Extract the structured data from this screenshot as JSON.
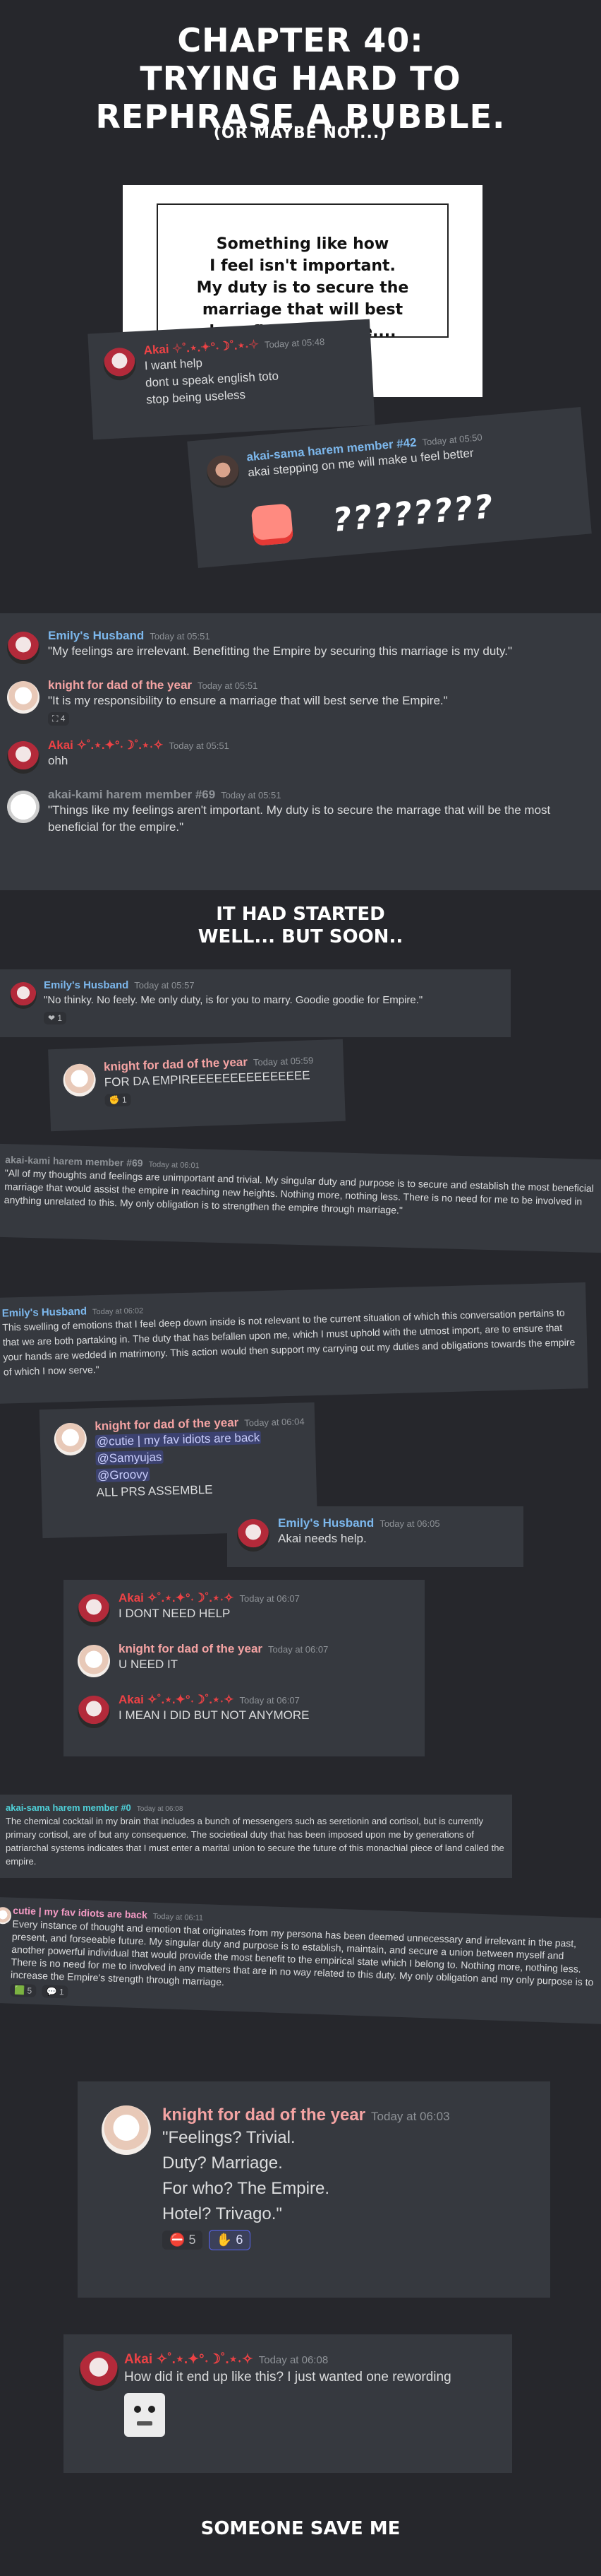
{
  "title": {
    "line1": "CHAPTER 40:",
    "line2": "TRYING HARD TO",
    "line3": "REPHRASE A BUBBLE.",
    "sub": "(OR MAYBE NOT...)"
  },
  "comic_box": {
    "text_l1": "Something like how",
    "text_l2": "I feel isn't important.",
    "text_l3": "My duty is to secure the",
    "text_l4": "marriage that will best",
    "text_l5": "benefit the Empire...."
  },
  "akai_card": {
    "name": "Akai ✧˚.⋆.✦°˖☽˚.⋆˖✧",
    "ts": "Today at 05:48",
    "l1": "I want help",
    "l2": "dont u speak english toto",
    "l3": "stop being useless"
  },
  "harem42": {
    "name": "akai-sama harem member #42",
    "ts": "Today at 05:50",
    "body": "akai stepping on me will make u feel better",
    "qmarks": "????????"
  },
  "chat1": {
    "m1_name": "Emily's Husband",
    "m1_ts": "Today at 05:51",
    "m1_body": "\"My feelings are irrelevant. Benefitting the Empire by securing this marriage is my duty.\"",
    "m2_name": "knight for dad of the year",
    "m2_ts": "Today at 05:51",
    "m2_body": "\"It is my responsibility to ensure a marriage that will best serve the Empire.\"",
    "m2_react": "4",
    "m3_name": "Akai ✧˚.⋆.✦°˖☽˚.⋆˖✧",
    "m3_ts": "Today at 05:51",
    "m3_body": "ohh",
    "m4_name": "akai-kami harem member #69",
    "m4_ts": "Today at 05:51",
    "m4_body": "\"Things like my feelings aren't important. My duty is to secure the marrage that will be the most beneficial for the empire.\""
  },
  "caption1": {
    "l1": "IT HAD STARTED",
    "l2": "WELL... BUT SOON.."
  },
  "p_emily2": {
    "name": "Emily's Husband",
    "ts": "Today at 05:57",
    "body": "\"No thinky. No feely. Me only duty, is for you to marry. Goodie goodie for Empire.\"",
    "react": "1"
  },
  "p_knight2": {
    "name": "knight for dad of the year",
    "ts": "Today at 05:59",
    "body": "FOR DA EMPIREEEEEEEEEEEEEEE",
    "react": "1"
  },
  "p_harem69": {
    "name": "akai-kami harem member #69",
    "ts": "Today at 06:01",
    "body": "\"All of my thoughts and feelings are unimportant and trivial. My singular duty and purpose is to secure and establish the most beneficial marriage that would assist the empire in reaching new heights. Nothing more, nothing less. There is no need for me to be involved in anything unrelated to this. My only obligation is to strengthen the empire through marriage.\""
  },
  "p_emily3": {
    "name": "Emily's Husband",
    "ts": "Today at 06:02",
    "body": "This swelling of emotions that I feel deep down inside is not relevant to the current situation of which this conversation pertains to that we are both partaking in. The duty that has befallen upon me, which I must uphold with the utmost import, are to ensure that your hands are wedded in matrimony. This action would then support my carrying out my duties and obligations towards the empire of which I now serve.\""
  },
  "p_knight3": {
    "name": "knight for dad of the year",
    "ts": "Today at 06:04",
    "m1": "@cutie | my fav idiots are back",
    "m2": "@Samyujas",
    "m3": "@Groovy",
    "l4": "ALL PRS ASSEMBLE"
  },
  "p_emily4": {
    "name": "Emily's Husband",
    "ts": "Today at 06:05",
    "body": "Akai needs help."
  },
  "p_seq": {
    "a1_name": "Akai ✧˚.⋆.✦°˖☽˚.⋆˖✧",
    "a1_ts": "Today at 06:07",
    "a1_body": "I DONT NEED HELP",
    "k_name": "knight for dad of the year",
    "k_ts": "Today at 06:07",
    "k_body": "U NEED IT",
    "a2_name": "Akai ✧˚.⋆.✦°˖☽˚.⋆˖✧",
    "a2_ts": "Today at 06:07",
    "a2_body": "I MEAN I DID BUT NOT ANYMORE"
  },
  "p_harem0": {
    "name": "akai-sama harem member #0",
    "ts": "Today at 06:08",
    "body": "The chemical cocktail in my brain that includes a bunch of messengers such as seretionin and cortisol, but is currently primary cortisol, are of but any consequence. The societieal duty that has been imposed upon me by generations of patriarchal systems indicates that I must enter a marital union to secure the future of this monachial piece of land called the empire."
  },
  "p_cutie": {
    "name": "cutie | my fav idiots are back",
    "ts": "Today at 06:11",
    "body": "Every instance of thought and emotion that originates from my persona has been deemed unnecessary and irrelevant in the past, present, and forseeable future. My singular duty and purpose is to establish, maintain, and secure a union between myself and another powerful individual that would provide the most benefit to the empirical state which I belong to. Nothing more, nothing less. There is no need for me to involved in any matters that are in no way related to this duty. My only obligation and my only purpose is to increase the Empire's strength through marriage.",
    "r1": "5",
    "r2": "1"
  },
  "p_knight_big": {
    "name": "knight for dad of the year",
    "ts": "Today at 06:03",
    "l1": "\"Feelings? Trivial.",
    "l2": "Duty? Marriage.",
    "l3": "For who? The Empire.",
    "l4": "Hotel? Trivago.\"",
    "r1": "5",
    "r2": "6"
  },
  "p_akai_big": {
    "name": "Akai ✧˚.⋆.✦°˖☽˚.⋆˖✧",
    "ts": "Today at 06:08",
    "body": "How did it end up like this? I just wanted one rewording"
  },
  "footer": {
    "text": "SOMEONE SAVE ME"
  },
  "colors": {
    "bg": "#26272c",
    "panel": "#36393f",
    "akai": "#ed4245",
    "knight": "#f4a3a3",
    "emily": "#7cb7ec"
  }
}
